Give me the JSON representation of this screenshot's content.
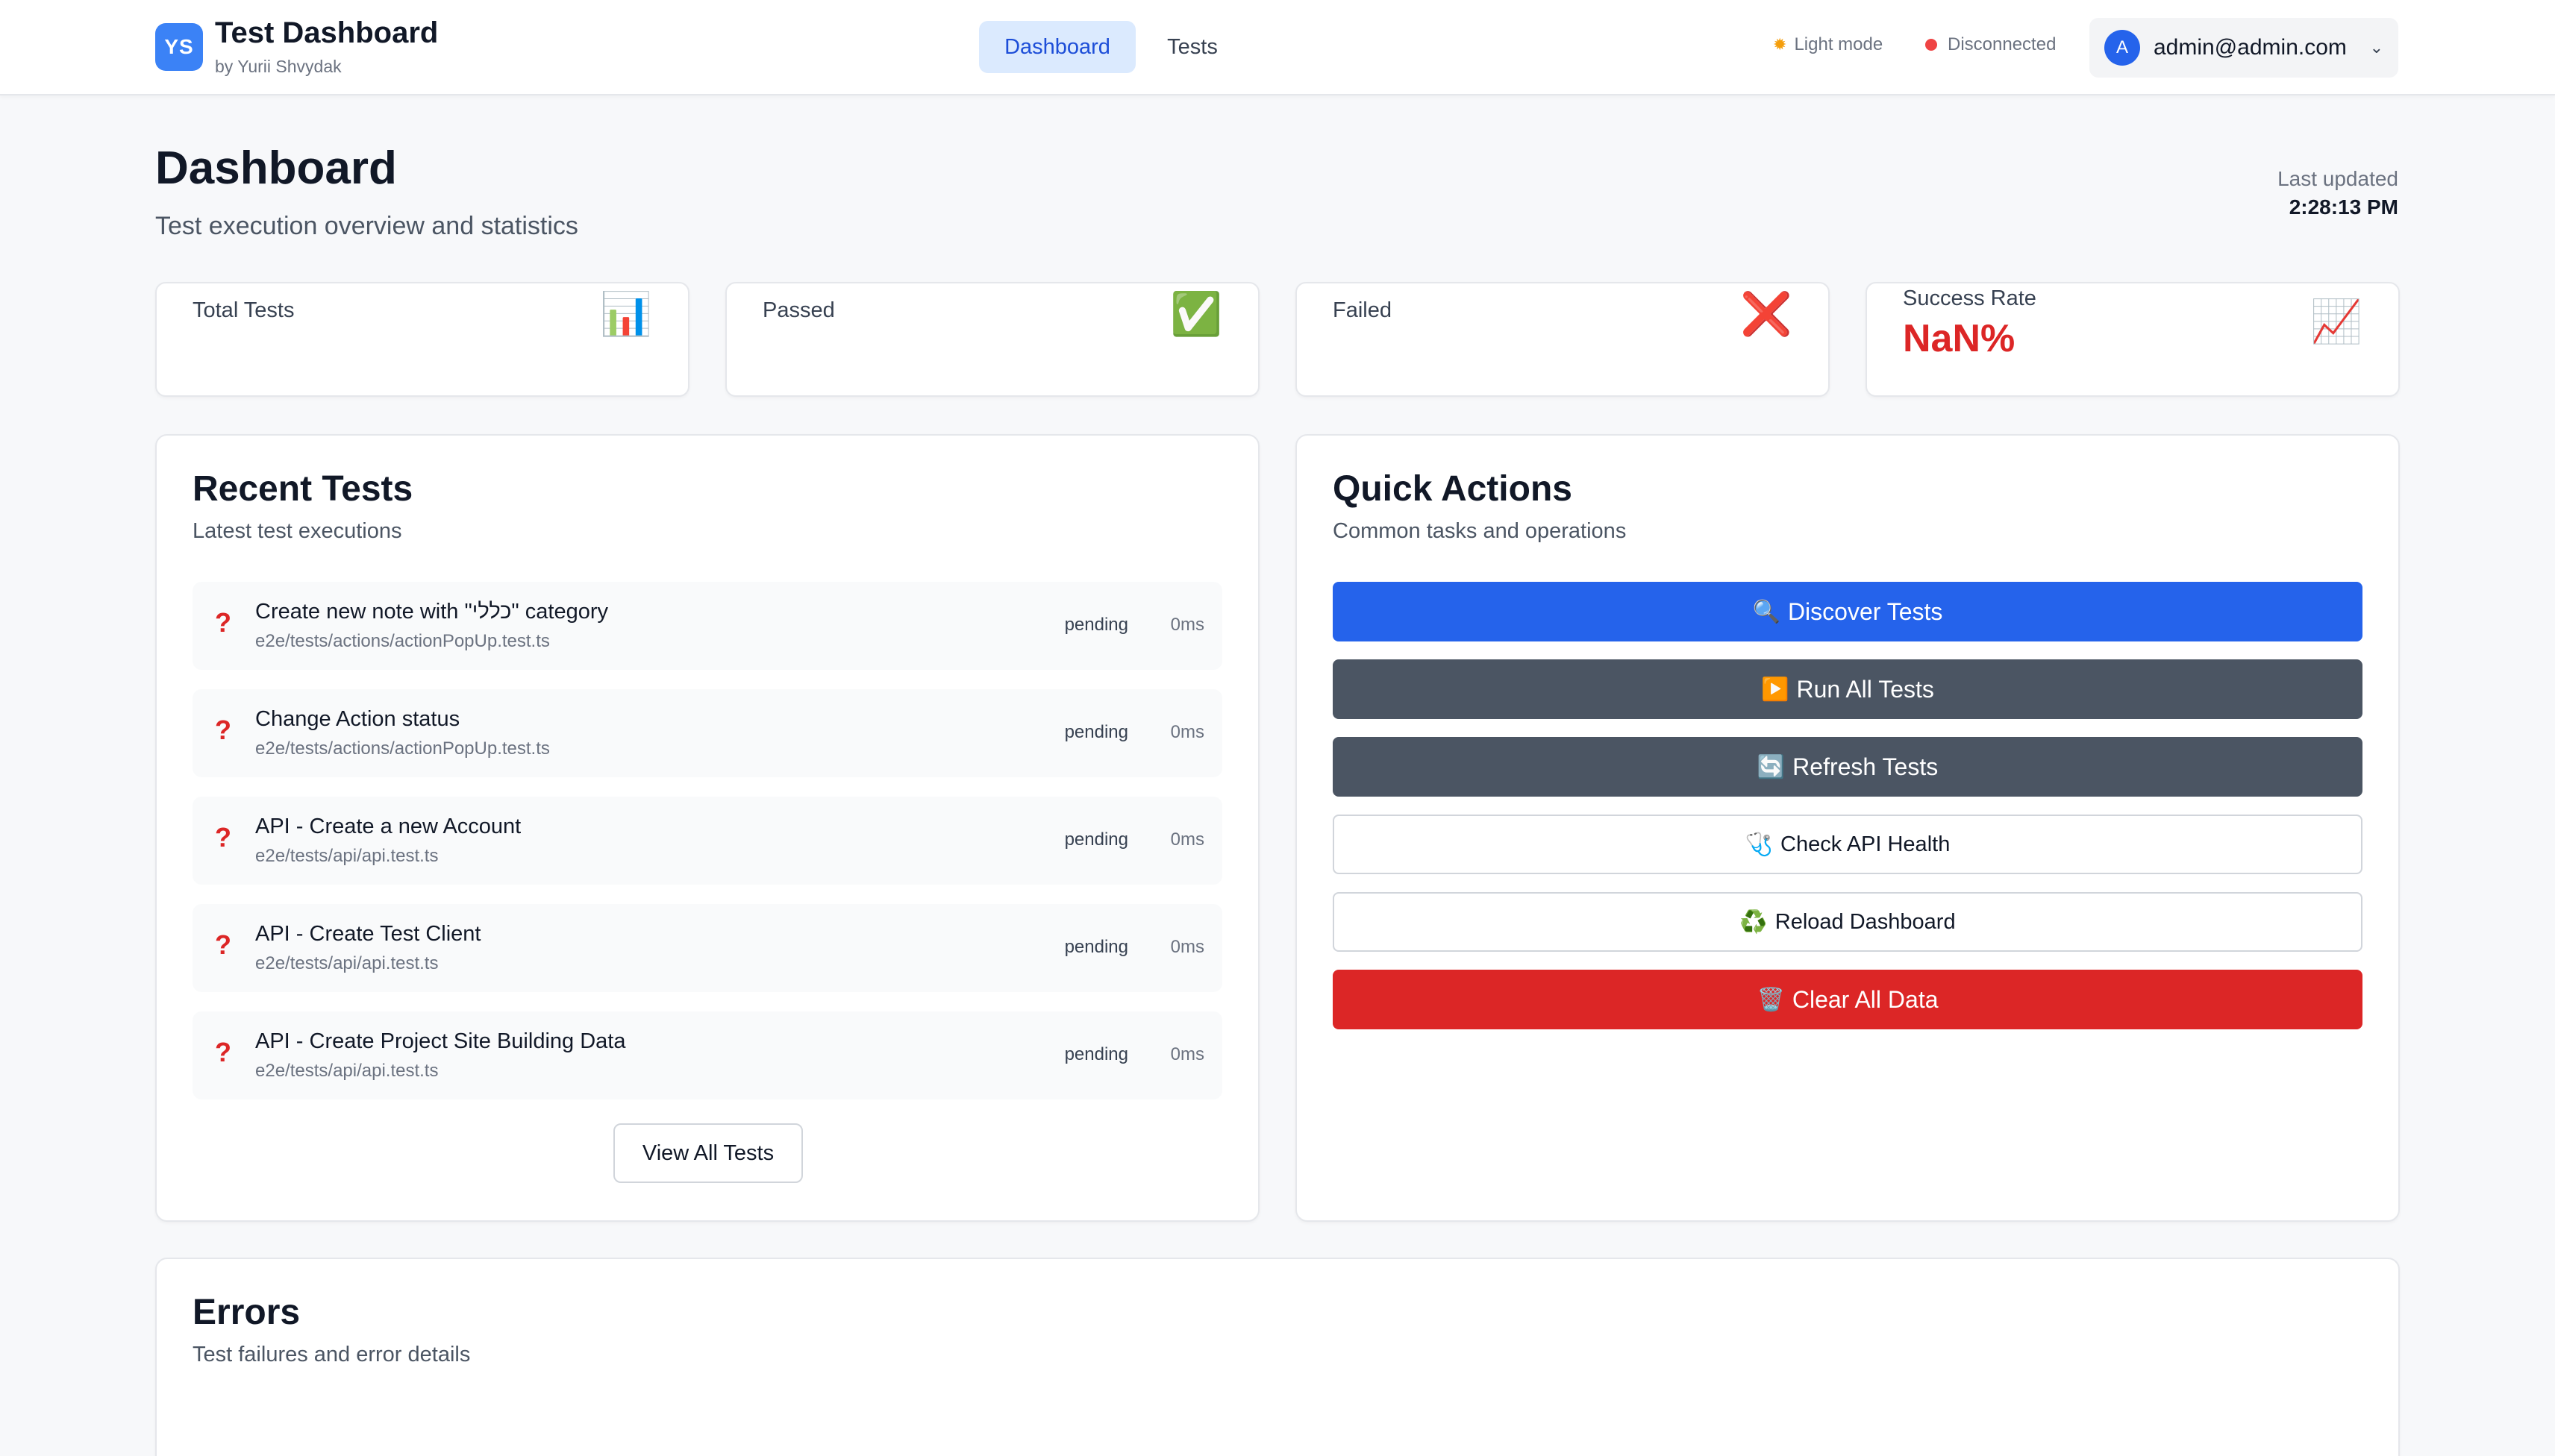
{
  "header": {
    "logo_initials": "YS",
    "title": "Test Dashboard",
    "subtitle": "by Yurii Shvydak",
    "nav": [
      {
        "label": "Dashboard",
        "active": true
      },
      {
        "label": "Tests",
        "active": false
      }
    ],
    "theme_label": "Light mode",
    "theme_icon": "sun-icon",
    "connection_label": "Disconnected",
    "connection_color": "#ef4444",
    "user": {
      "avatar_initial": "A",
      "email": "admin@admin.com"
    }
  },
  "page": {
    "title": "Dashboard",
    "subtitle": "Test execution overview and statistics",
    "last_updated_label": "Last updated",
    "last_updated_value": "2:28:13 PM"
  },
  "stats": [
    {
      "label": "Total Tests",
      "value": "",
      "icon": "📊",
      "icon_name": "bar-chart-icon"
    },
    {
      "label": "Passed",
      "value": "",
      "icon": "✅",
      "icon_name": "check-icon"
    },
    {
      "label": "Failed",
      "value": "",
      "icon": "❌",
      "icon_name": "cross-icon"
    },
    {
      "label": "Success Rate",
      "value": "NaN%",
      "icon": "📈",
      "icon_name": "trend-icon"
    }
  ],
  "recent": {
    "title": "Recent Tests",
    "subtitle": "Latest test executions",
    "tests": [
      {
        "name": "Create new note with \"כללי\" category",
        "path": "e2e/tests/actions/actionPopUp.test.ts",
        "status": "pending",
        "duration": "0ms"
      },
      {
        "name": "Change Action status",
        "path": "e2e/tests/actions/actionPopUp.test.ts",
        "status": "pending",
        "duration": "0ms"
      },
      {
        "name": "API - Create a new Account",
        "path": "e2e/tests/api/api.test.ts",
        "status": "pending",
        "duration": "0ms"
      },
      {
        "name": "API - Create Test Client",
        "path": "e2e/tests/api/api.test.ts",
        "status": "pending",
        "duration": "0ms"
      },
      {
        "name": "API - Create Project Site Building Data",
        "path": "e2e/tests/api/api.test.ts",
        "status": "pending",
        "duration": "0ms"
      }
    ],
    "status_icon": "?",
    "view_all_label": "View All Tests"
  },
  "quick_actions": {
    "title": "Quick Actions",
    "subtitle": "Common tasks and operations",
    "buttons": [
      {
        "label": "Discover Tests",
        "icon": "🔍",
        "icon_name": "magnifier-icon",
        "style": "primary"
      },
      {
        "label": "Run All Tests",
        "icon": "▶️",
        "icon_name": "play-icon",
        "style": "dark"
      },
      {
        "label": "Refresh Tests",
        "icon": "🔄",
        "icon_name": "refresh-icon",
        "style": "dark"
      },
      {
        "label": "Check API Health",
        "icon": "🩺",
        "icon_name": "stethoscope-icon",
        "style": "outline"
      },
      {
        "label": "Reload Dashboard",
        "icon": "♻️",
        "icon_name": "recycle-icon",
        "style": "outline"
      },
      {
        "label": "Clear All Data",
        "icon": "🗑️",
        "icon_name": "trash-icon",
        "style": "danger"
      }
    ]
  },
  "errors": {
    "title": "Errors",
    "subtitle": "Test failures and error details"
  },
  "colors": {
    "accent": "#2563eb",
    "danger": "#dc2626",
    "dark_button": "#4b5563"
  }
}
